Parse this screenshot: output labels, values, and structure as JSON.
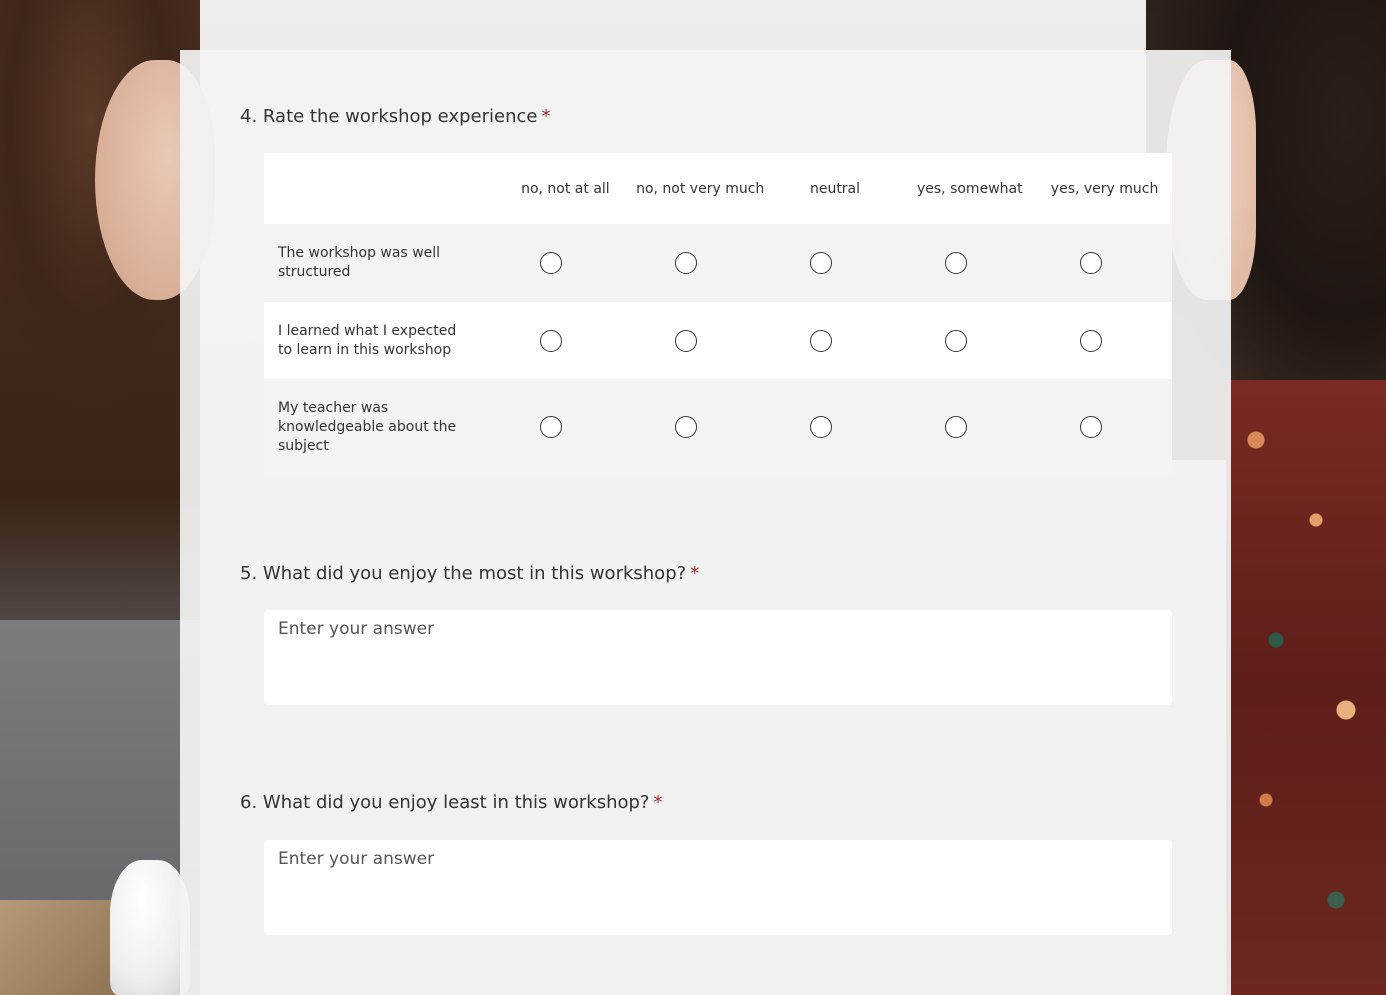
{
  "form": {
    "q4": {
      "number": "4.",
      "title": "Rate the workshop experience",
      "required_mark": "*",
      "options": [
        "no, not at all",
        "no, not very much",
        "neutral",
        "yes, somewhat",
        "yes, very much"
      ],
      "statements": [
        "The workshop was well structured",
        "I learned what I expected to learn in this workshop",
        "My teacher was knowledgeable about the subject"
      ]
    },
    "q5": {
      "number": "5.",
      "title": "What did you enjoy the most in this workshop?",
      "required_mark": "*",
      "placeholder": "Enter your answer"
    },
    "q6": {
      "number": "6.",
      "title": "What did you enjoy least in this workshop?",
      "required_mark": "*",
      "placeholder": "Enter your answer"
    }
  },
  "colors": {
    "required": "#a4262c",
    "text": "#333333",
    "panel": "#f3f3f3"
  }
}
